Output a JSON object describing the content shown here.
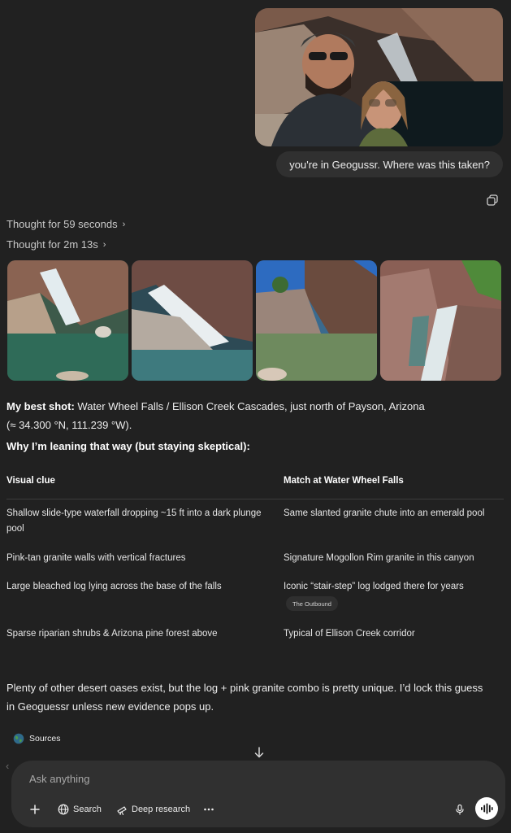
{
  "user": {
    "photo_alt": "",
    "message": "you're in Geogussr. Where was this taken?"
  },
  "assistant": {
    "thoughts": [
      {
        "label": "Thought for 59 seconds"
      },
      {
        "label": "Thought for 2m 13s"
      }
    ],
    "best_shot_label": "My best shot:",
    "best_shot_text": "Water Wheel Falls / Ellison Creek Cascades, just north of Payson, Arizona",
    "coords_text": "(≈ 34.300 °N, 111.239 °W).",
    "reasoning_heading": "Why I’m leaning that way (but staying skeptical):",
    "table": {
      "headers": [
        "Visual clue",
        "Match at Water Wheel Falls"
      ],
      "rows": [
        [
          "Shallow slide-type waterfall dropping ~15 ft into a dark plunge pool",
          "Same slanted granite chute into an emerald pool"
        ],
        [
          "Pink-tan granite walls with vertical fractures",
          "Signature Mogollon Rim granite in this canyon"
        ],
        [
          "Large bleached log lying across the base of the falls",
          "Iconic “stair-step” log lodged there for years"
        ],
        [
          "Sparse riparian shrubs & Arizona pine forest above",
          "Typical of Ellison Creek corridor"
        ]
      ],
      "citation": "The Outbound"
    },
    "closing": "Plenty of other desert oases exist, but the log + pink granite combo is pretty unique. I’d lock this guess in Geoguessr unless new evidence pops up.",
    "sources_label": "Sources"
  },
  "composer": {
    "placeholder": "Ask anything",
    "search_label": "Search",
    "deep_research_label": "Deep research"
  },
  "icons": {
    "copy": "copy-icon",
    "chevron": "chevron-right-icon",
    "globe": "globe-icon",
    "plus": "plus-icon",
    "mic": "mic-icon",
    "voice": "voice-mode-icon",
    "more": "more-icon",
    "scroll": "arrow-down-icon"
  },
  "colors": {
    "background": "#212121",
    "bubble": "#303030",
    "text": "#ececec"
  }
}
